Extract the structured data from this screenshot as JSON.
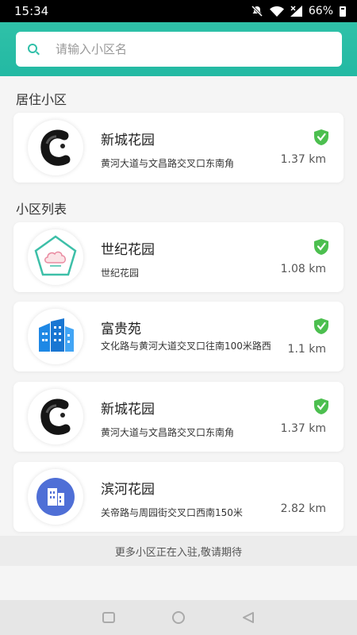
{
  "status": {
    "time": "15:34",
    "battery": "66%"
  },
  "search": {
    "placeholder": "请输入小区名"
  },
  "residence": {
    "title": "居住小区",
    "item": {
      "name": "新城花园",
      "address": "黄河大道与文昌路交叉口东南角",
      "distance": "1.37 km",
      "verified": true,
      "logo": "ink-circle-logo"
    }
  },
  "list": {
    "title": "小区列表",
    "items": [
      {
        "name": "世纪花园",
        "address": "世纪花园",
        "distance": "1.08 km",
        "verified": true,
        "logo": "pentagon-cloud-logo"
      },
      {
        "name": "富贵苑",
        "address": "文化路与黄河大道交叉口往南100米路西",
        "distance": "1.1 km",
        "verified": true,
        "logo": "blue-buildings-logo"
      },
      {
        "name": "新城花园",
        "address": "黄河大道与文昌路交叉口东南角",
        "distance": "1.37 km",
        "verified": true,
        "logo": "ink-circle-logo"
      },
      {
        "name": "滨河花园",
        "address": "关帝路与周园街交叉口西南150米",
        "distance": "2.82 km",
        "verified": false,
        "logo": "building-icon-logo"
      }
    ]
  },
  "footer": {
    "note": "更多小区正在入驻,敬请期待"
  },
  "colors": {
    "accent": "#2fbfa8",
    "verified": "#4cbf4f",
    "logo_blue": "#1e88e5"
  }
}
